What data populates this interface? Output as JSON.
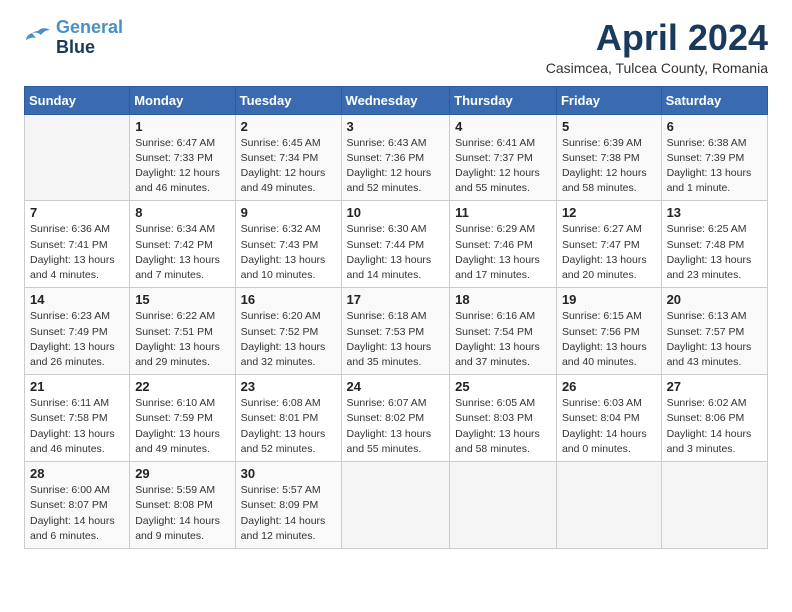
{
  "logo": {
    "line1": "General",
    "line2": "Blue"
  },
  "title": "April 2024",
  "subtitle": "Casimcea, Tulcea County, Romania",
  "days_of_week": [
    "Sunday",
    "Monday",
    "Tuesday",
    "Wednesday",
    "Thursday",
    "Friday",
    "Saturday"
  ],
  "weeks": [
    [
      {
        "day": "",
        "info": ""
      },
      {
        "day": "1",
        "info": "Sunrise: 6:47 AM\nSunset: 7:33 PM\nDaylight: 12 hours\nand 46 minutes."
      },
      {
        "day": "2",
        "info": "Sunrise: 6:45 AM\nSunset: 7:34 PM\nDaylight: 12 hours\nand 49 minutes."
      },
      {
        "day": "3",
        "info": "Sunrise: 6:43 AM\nSunset: 7:36 PM\nDaylight: 12 hours\nand 52 minutes."
      },
      {
        "day": "4",
        "info": "Sunrise: 6:41 AM\nSunset: 7:37 PM\nDaylight: 12 hours\nand 55 minutes."
      },
      {
        "day": "5",
        "info": "Sunrise: 6:39 AM\nSunset: 7:38 PM\nDaylight: 12 hours\nand 58 minutes."
      },
      {
        "day": "6",
        "info": "Sunrise: 6:38 AM\nSunset: 7:39 PM\nDaylight: 13 hours\nand 1 minute."
      }
    ],
    [
      {
        "day": "7",
        "info": "Sunrise: 6:36 AM\nSunset: 7:41 PM\nDaylight: 13 hours\nand 4 minutes."
      },
      {
        "day": "8",
        "info": "Sunrise: 6:34 AM\nSunset: 7:42 PM\nDaylight: 13 hours\nand 7 minutes."
      },
      {
        "day": "9",
        "info": "Sunrise: 6:32 AM\nSunset: 7:43 PM\nDaylight: 13 hours\nand 10 minutes."
      },
      {
        "day": "10",
        "info": "Sunrise: 6:30 AM\nSunset: 7:44 PM\nDaylight: 13 hours\nand 14 minutes."
      },
      {
        "day": "11",
        "info": "Sunrise: 6:29 AM\nSunset: 7:46 PM\nDaylight: 13 hours\nand 17 minutes."
      },
      {
        "day": "12",
        "info": "Sunrise: 6:27 AM\nSunset: 7:47 PM\nDaylight: 13 hours\nand 20 minutes."
      },
      {
        "day": "13",
        "info": "Sunrise: 6:25 AM\nSunset: 7:48 PM\nDaylight: 13 hours\nand 23 minutes."
      }
    ],
    [
      {
        "day": "14",
        "info": "Sunrise: 6:23 AM\nSunset: 7:49 PM\nDaylight: 13 hours\nand 26 minutes."
      },
      {
        "day": "15",
        "info": "Sunrise: 6:22 AM\nSunset: 7:51 PM\nDaylight: 13 hours\nand 29 minutes."
      },
      {
        "day": "16",
        "info": "Sunrise: 6:20 AM\nSunset: 7:52 PM\nDaylight: 13 hours\nand 32 minutes."
      },
      {
        "day": "17",
        "info": "Sunrise: 6:18 AM\nSunset: 7:53 PM\nDaylight: 13 hours\nand 35 minutes."
      },
      {
        "day": "18",
        "info": "Sunrise: 6:16 AM\nSunset: 7:54 PM\nDaylight: 13 hours\nand 37 minutes."
      },
      {
        "day": "19",
        "info": "Sunrise: 6:15 AM\nSunset: 7:56 PM\nDaylight: 13 hours\nand 40 minutes."
      },
      {
        "day": "20",
        "info": "Sunrise: 6:13 AM\nSunset: 7:57 PM\nDaylight: 13 hours\nand 43 minutes."
      }
    ],
    [
      {
        "day": "21",
        "info": "Sunrise: 6:11 AM\nSunset: 7:58 PM\nDaylight: 13 hours\nand 46 minutes."
      },
      {
        "day": "22",
        "info": "Sunrise: 6:10 AM\nSunset: 7:59 PM\nDaylight: 13 hours\nand 49 minutes."
      },
      {
        "day": "23",
        "info": "Sunrise: 6:08 AM\nSunset: 8:01 PM\nDaylight: 13 hours\nand 52 minutes."
      },
      {
        "day": "24",
        "info": "Sunrise: 6:07 AM\nSunset: 8:02 PM\nDaylight: 13 hours\nand 55 minutes."
      },
      {
        "day": "25",
        "info": "Sunrise: 6:05 AM\nSunset: 8:03 PM\nDaylight: 13 hours\nand 58 minutes."
      },
      {
        "day": "26",
        "info": "Sunrise: 6:03 AM\nSunset: 8:04 PM\nDaylight: 14 hours\nand 0 minutes."
      },
      {
        "day": "27",
        "info": "Sunrise: 6:02 AM\nSunset: 8:06 PM\nDaylight: 14 hours\nand 3 minutes."
      }
    ],
    [
      {
        "day": "28",
        "info": "Sunrise: 6:00 AM\nSunset: 8:07 PM\nDaylight: 14 hours\nand 6 minutes."
      },
      {
        "day": "29",
        "info": "Sunrise: 5:59 AM\nSunset: 8:08 PM\nDaylight: 14 hours\nand 9 minutes."
      },
      {
        "day": "30",
        "info": "Sunrise: 5:57 AM\nSunset: 8:09 PM\nDaylight: 14 hours\nand 12 minutes."
      },
      {
        "day": "",
        "info": ""
      },
      {
        "day": "",
        "info": ""
      },
      {
        "day": "",
        "info": ""
      },
      {
        "day": "",
        "info": ""
      }
    ]
  ]
}
